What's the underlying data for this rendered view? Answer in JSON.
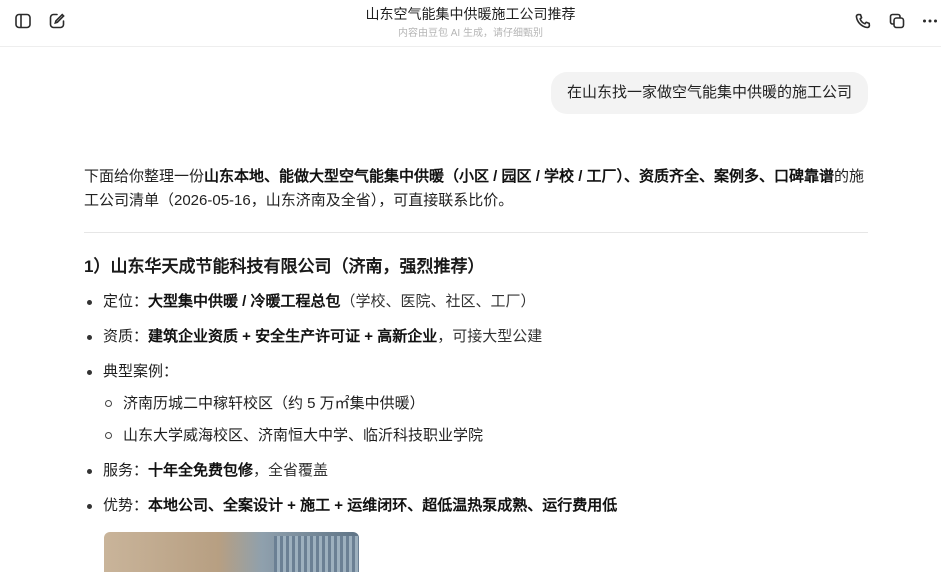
{
  "header": {
    "title": "山东空气能集中供暖施工公司推荐",
    "subtitle": "内容由豆包 AI 生成，请仔细甄别",
    "icons": [
      "sidebar-toggle-icon",
      "edit-icon",
      "phone-icon",
      "copy-icon",
      "more-icon"
    ]
  },
  "user_message": "在山东找一家做空气能集中供暖的施工公司",
  "answer": {
    "intro": {
      "p1": "下面给你整理一份",
      "b1": "山东本地、能做大型空气能集中供暖（小区 / 园区 / 学校 / 工厂）、资质齐全、案例多、口碑靠谱",
      "p2": "的施工公司清单（2026-05-16，山东济南及全省），可直接联系比价。"
    },
    "section1": {
      "title": "1）山东华天成节能科技有限公司（济南，强烈推荐）",
      "items": {
        "positioning": {
          "label": "定位：",
          "bold": "大型集中供暖 / 冷暖工程总包",
          "rest": "（学校、医院、社区、工厂）"
        },
        "qualification": {
          "label": "资质：",
          "bold": "建筑企业资质 + 安全生产许可证 + 高新企业",
          "rest": "，可接大型公建"
        },
        "cases": {
          "label": "典型案例：",
          "list": [
            "济南历城二中稼轩校区（约 5 万㎡集中供暖）",
            "山东大学威海校区、济南恒大中学、临沂科技职业学院"
          ]
        },
        "service": {
          "label": "服务：",
          "bold": "十年全免费包修",
          "rest": "，全省覆盖"
        },
        "advantage": {
          "label": "优势：",
          "bold": "本地公司、全案设计 + 施工 + 运维闭环、超低温热泵成熟、运行费用低"
        }
      }
    }
  }
}
